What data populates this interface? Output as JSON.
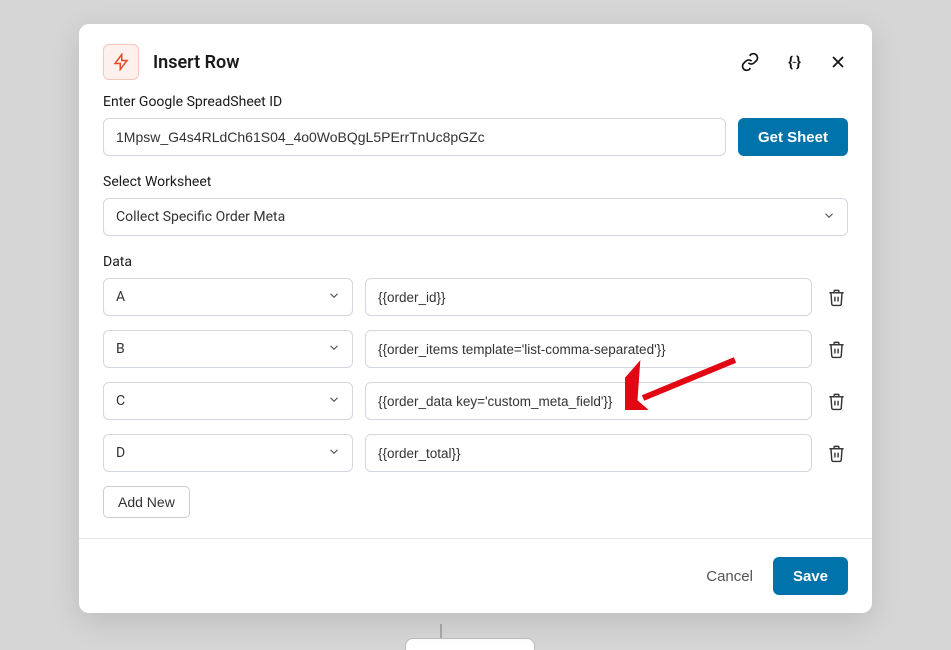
{
  "modal": {
    "title": "Insert Row",
    "spreadsheet_label": "Enter Google SpreadSheet ID",
    "spreadsheet_value": "1Mpsw_G4s4RLdCh61S04_4o0WoBQgL5PErrTnUc8pGZc",
    "get_sheet_label": "Get Sheet",
    "worksheet_label": "Select Worksheet",
    "worksheet_value": "Collect Specific Order Meta",
    "data_label": "Data",
    "rows": [
      {
        "column": "A",
        "value": "{{order_id}}"
      },
      {
        "column": "B",
        "value": "{{order_items template='list-comma-separated'}}"
      },
      {
        "column": "C",
        "value": "{{order_data key='custom_meta_field'}}"
      },
      {
        "column": "D",
        "value": "{{order_total}}"
      }
    ],
    "add_new_label": "Add New",
    "cancel_label": "Cancel",
    "save_label": "Save"
  },
  "colors": {
    "primary": "#0073aa",
    "accent_bg": "#fdf1ee",
    "accent_border": "#f6c6bd",
    "accent_stroke": "#e44a2a"
  }
}
